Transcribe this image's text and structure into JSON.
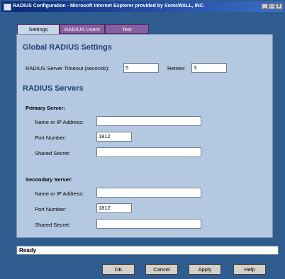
{
  "window": {
    "title": "RADIUS Configuration - Microsoft Internet Explorer provided by SonicWALL, INC.",
    "controls": {
      "minimize": "_",
      "maximize": "□",
      "close": "x"
    }
  },
  "tabs": [
    {
      "label": "Settings",
      "active": true
    },
    {
      "label": "RADIUS Users",
      "active": false
    },
    {
      "label": "Test",
      "active": false
    }
  ],
  "global": {
    "heading": "Global RADIUS Settings",
    "timeout_label": "RADIUS Server Timeout (seconds):",
    "timeout_value": "5",
    "retries_label": "Retries:",
    "retries_value": "3"
  },
  "servers": {
    "heading": "RADIUS Servers",
    "primary": {
      "heading": "Primary Server:",
      "name_label": "Name or IP Address:",
      "name_value": "",
      "port_label": "Port Number:",
      "port_value": "1812",
      "secret_label": "Shared Secret:",
      "secret_value": ""
    },
    "secondary": {
      "heading": "Secondary Server:",
      "name_label": "Name or IP Address:",
      "name_value": "",
      "port_label": "Port Number:",
      "port_value": "1812",
      "secret_label": "Shared Secret:",
      "secret_value": ""
    }
  },
  "status": {
    "text": "Ready"
  },
  "buttons": {
    "ok": "OK",
    "cancel": "Cancel",
    "apply": "Apply",
    "help": "Help"
  },
  "colors": {
    "frame": "#2f5d8f",
    "panel": "#b4c9e1",
    "heading": "#203e78",
    "tab_inactive": "#8a5ea2"
  }
}
